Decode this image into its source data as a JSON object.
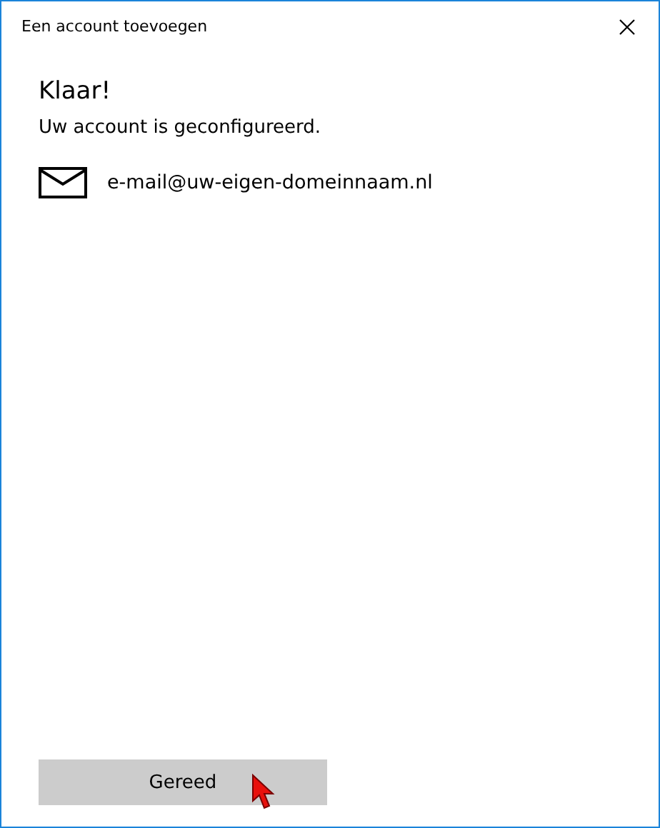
{
  "window": {
    "title": "Een account toevoegen"
  },
  "heading": "Klaar!",
  "message": "Uw account is geconfigureerd.",
  "account": {
    "email": "e-mail@uw-eigen-domeinnaam.nl"
  },
  "buttons": [
    {
      "label": "Gereed"
    }
  ]
}
